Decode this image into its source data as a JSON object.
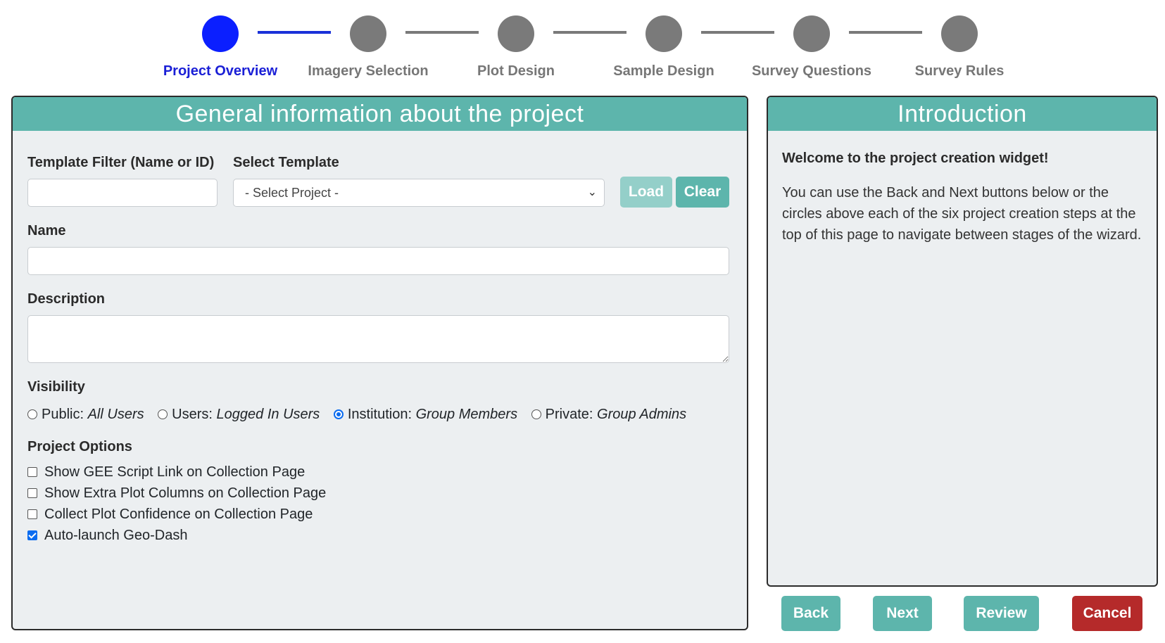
{
  "stepper": {
    "steps": [
      {
        "label": "Project Overview",
        "active": true
      },
      {
        "label": "Imagery Selection",
        "active": false
      },
      {
        "label": "Plot Design",
        "active": false
      },
      {
        "label": "Sample Design",
        "active": false
      },
      {
        "label": "Survey Questions",
        "active": false
      },
      {
        "label": "Survey Rules",
        "active": false
      }
    ]
  },
  "main": {
    "title": "General information about the project",
    "template_filter": {
      "label": "Template Filter (Name or ID)",
      "value": "",
      "placeholder": ""
    },
    "select_template": {
      "label": "Select Template",
      "selected": "- Select Project -"
    },
    "load_label": "Load",
    "clear_label": "Clear",
    "name": {
      "label": "Name",
      "value": ""
    },
    "description": {
      "label": "Description",
      "value": ""
    },
    "visibility": {
      "label": "Visibility",
      "options": [
        {
          "prefix": "Public:",
          "detail": "All Users",
          "checked": false
        },
        {
          "prefix": "Users:",
          "detail": "Logged In Users",
          "checked": false
        },
        {
          "prefix": "Institution:",
          "detail": "Group Members",
          "checked": true
        },
        {
          "prefix": "Private:",
          "detail": "Group Admins",
          "checked": false
        }
      ]
    },
    "project_options": {
      "label": "Project Options",
      "options": [
        {
          "label": "Show GEE Script Link on Collection Page",
          "checked": false
        },
        {
          "label": "Show Extra Plot Columns on Collection Page",
          "checked": false
        },
        {
          "label": "Collect Plot Confidence on Collection Page",
          "checked": false
        },
        {
          "label": "Auto-launch Geo-Dash",
          "checked": true
        }
      ]
    }
  },
  "intro": {
    "title": "Introduction",
    "heading": "Welcome to the project creation widget!",
    "text": "You can use the Back and Next buttons below or the circles above each of the six project creation steps at the top of this page to navigate between stages of the wizard."
  },
  "nav": {
    "back_label": "Back",
    "next_label": "Next",
    "review_label": "Review",
    "cancel_label": "Cancel"
  },
  "colors": {
    "accent_teal": "#5db5ac",
    "active_step": "#0b1fff",
    "inactive_step": "#7a7a7a",
    "cancel_red": "#b52a2a"
  }
}
